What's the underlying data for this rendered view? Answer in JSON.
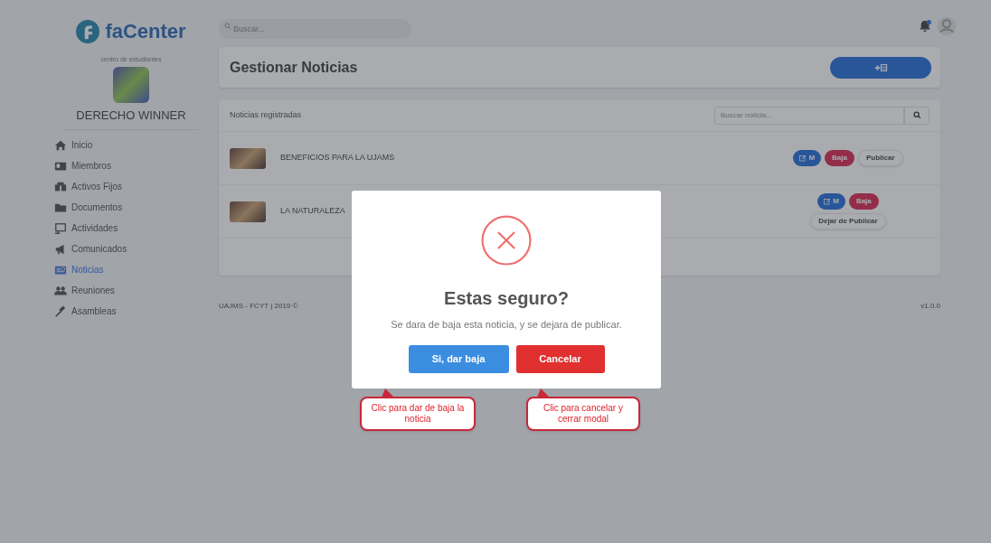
{
  "brand": {
    "name": "faCenter"
  },
  "sidebar": {
    "tagline": "centro de estudiantes",
    "org_name": "DERECHO WINNER",
    "items": [
      {
        "label": "Inicio",
        "selected": false
      },
      {
        "label": "Miembros",
        "selected": false
      },
      {
        "label": "Activos Fijos",
        "selected": false
      },
      {
        "label": "Documentos",
        "selected": false
      },
      {
        "label": "Actividades",
        "selected": false
      },
      {
        "label": "Comunicados",
        "selected": false
      },
      {
        "label": "Noticias",
        "selected": true
      },
      {
        "label": "Reuniones",
        "selected": false
      },
      {
        "label": "Asambleas",
        "selected": false
      }
    ]
  },
  "topbar": {
    "search_placeholder": "Buscar..."
  },
  "header": {
    "title": "Gestionar Noticias"
  },
  "news_list": {
    "title": "Noticias registradas",
    "search_placeholder": "Buscar noticia...",
    "rows": [
      {
        "title": "BENEFICIOS PARA LA UJAMS",
        "edit_label": "M",
        "delete_label": "Baja",
        "publish_label": "Publicar"
      },
      {
        "title": "LA NATURALEZA",
        "edit_label": "M",
        "delete_label": "Baja",
        "publish_label": "Dejar de Publicar"
      }
    ]
  },
  "footer": {
    "left": "UAJMS - FCYT | 2019 ©",
    "version": "v1.0.0"
  },
  "modal": {
    "title": "Estas seguro?",
    "message": "Se dara de baja esta noticia, y se dejara de publicar.",
    "confirm_label": "Si, dar baja",
    "cancel_label": "Cancelar"
  },
  "callouts": [
    {
      "text": "Clic para dar de baja la noticia"
    },
    {
      "text": "Clic para cancelar y cerrar modal"
    }
  ]
}
